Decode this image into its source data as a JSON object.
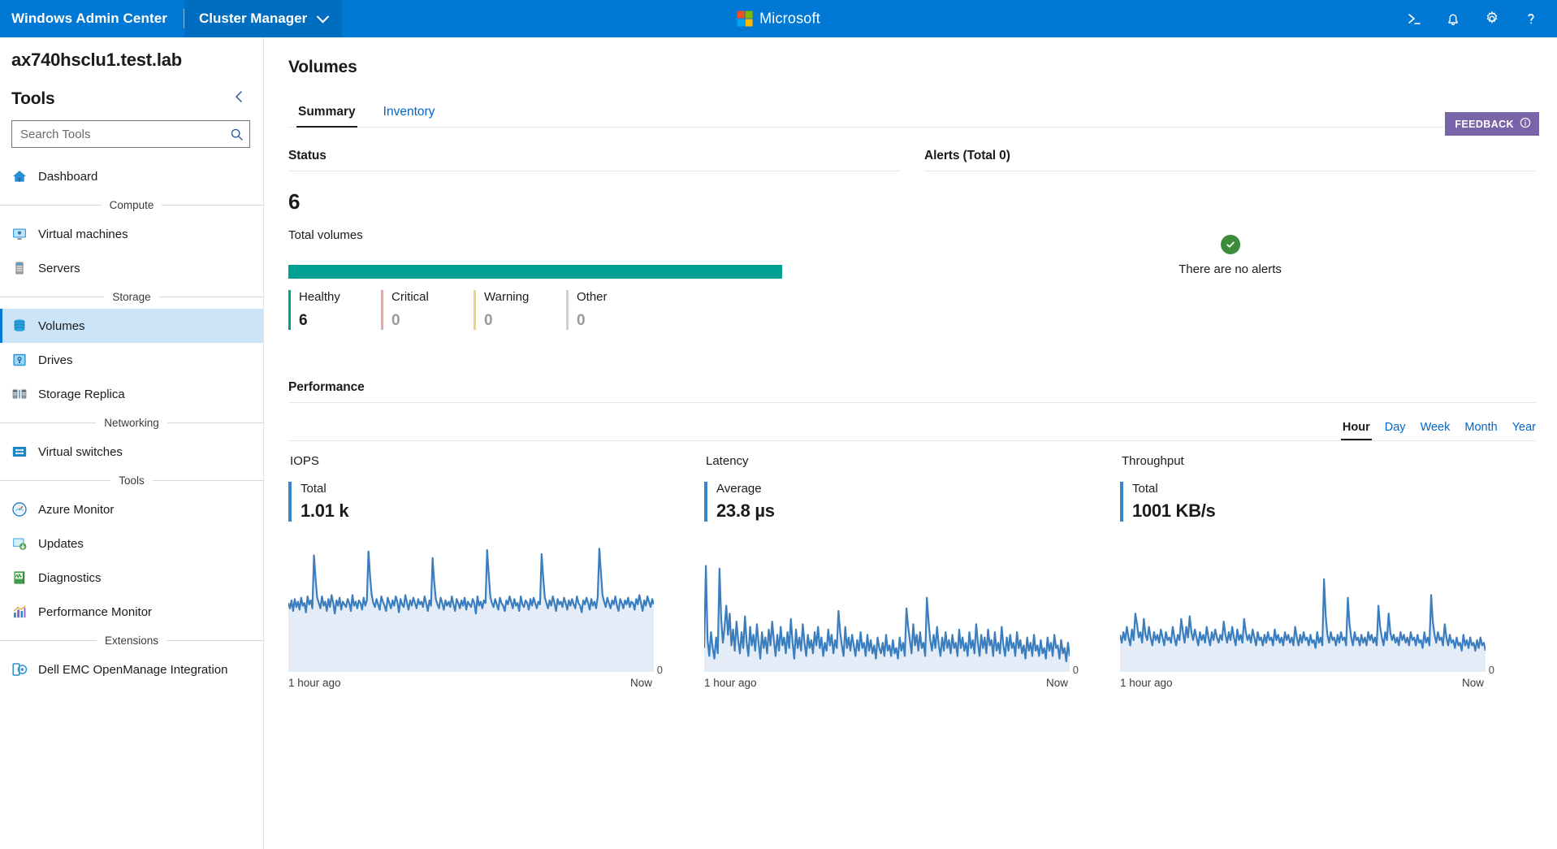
{
  "topbar": {
    "product_name": "Windows Admin Center",
    "solution": "Cluster Manager",
    "solution_chevron_icon": "chevron-down-icon",
    "center_logo_text": "Microsoft",
    "actions": [
      {
        "name": "powershell-icon",
        "label": ">_"
      },
      {
        "name": "notifications-bell-icon",
        "label": "Notifications"
      },
      {
        "name": "settings-gear-icon",
        "label": "Settings"
      },
      {
        "name": "help-question-icon",
        "label": "?"
      }
    ],
    "accent_color": "#0078d4"
  },
  "sidebar": {
    "cluster_name": "ax740hsclu1.test.lab",
    "tools_heading": "Tools",
    "collapse_icon": "chevron-left-icon",
    "search": {
      "placeholder": "Search Tools",
      "value": "",
      "icon": "search-icon"
    },
    "items": [
      {
        "type": "item",
        "label": "Dashboard",
        "icon": "home-icon",
        "selected": false
      },
      {
        "type": "group",
        "label": "Compute"
      },
      {
        "type": "item",
        "label": "Virtual machines",
        "icon": "monitor-icon",
        "selected": false
      },
      {
        "type": "item",
        "label": "Servers",
        "icon": "server-icon",
        "selected": false
      },
      {
        "type": "group",
        "label": "Storage"
      },
      {
        "type": "item",
        "label": "Volumes",
        "icon": "database-icon",
        "selected": true
      },
      {
        "type": "item",
        "label": "Drives",
        "icon": "hard-drive-icon",
        "selected": false
      },
      {
        "type": "item",
        "label": "Storage Replica",
        "icon": "replica-icon",
        "selected": false
      },
      {
        "type": "group",
        "label": "Networking"
      },
      {
        "type": "item",
        "label": "Virtual switches",
        "icon": "switch-icon",
        "selected": false
      },
      {
        "type": "group",
        "label": "Tools"
      },
      {
        "type": "item",
        "label": "Azure Monitor",
        "icon": "gauge-icon",
        "selected": false
      },
      {
        "type": "item",
        "label": "Updates",
        "icon": "updates-icon",
        "selected": false
      },
      {
        "type": "item",
        "label": "Diagnostics",
        "icon": "diagnostics-icon",
        "selected": false
      },
      {
        "type": "item",
        "label": "Performance Monitor",
        "icon": "perf-chart-icon",
        "selected": false
      },
      {
        "type": "group",
        "label": "Extensions"
      },
      {
        "type": "item",
        "label": "Dell EMC OpenManage Integration",
        "icon": "dell-openmanage-icon",
        "selected": false
      }
    ]
  },
  "feedback": {
    "label": "FEEDBACK",
    "icon": "info-circle-icon",
    "color": "#7a64a8"
  },
  "main": {
    "page_title": "Volumes",
    "tabs": [
      {
        "label": "Summary",
        "active": true
      },
      {
        "label": "Inventory",
        "active": false
      }
    ],
    "status": {
      "heading": "Status",
      "total_value": "6",
      "total_label": "Total volumes",
      "bar_color": "#00a193",
      "legend": [
        {
          "label": "Healthy",
          "value": "6",
          "color": "#00a193",
          "zero": false
        },
        {
          "label": "Critical",
          "value": "0",
          "color": "#f1a3a3",
          "zero": true
        },
        {
          "label": "Warning",
          "value": "0",
          "color": "#f5d37a",
          "zero": true
        },
        {
          "label": "Other",
          "value": "0",
          "color": "#cfcfcf",
          "zero": true
        }
      ]
    },
    "alerts": {
      "heading": "Alerts (Total 0)",
      "empty_text": "There are no alerts",
      "empty_icon": "green-check-circle-icon"
    },
    "performance": {
      "heading": "Performance",
      "ranges": [
        {
          "label": "Hour",
          "active": true
        },
        {
          "label": "Day",
          "active": false
        },
        {
          "label": "Week",
          "active": false
        },
        {
          "label": "Month",
          "active": false
        },
        {
          "label": "Year",
          "active": false
        }
      ],
      "metrics": [
        {
          "title": "IOPS",
          "kpi_label": "Total",
          "kpi_value": "1.01 k",
          "axis_zero": "0",
          "foot_left": "1 hour ago",
          "foot_right": "Now"
        },
        {
          "title": "Latency",
          "kpi_label": "Average",
          "kpi_value": "23.8 µs",
          "axis_zero": "0",
          "foot_left": "1 hour ago",
          "foot_right": "Now"
        },
        {
          "title": "Throughput",
          "kpi_label": "Total",
          "kpi_value": "1001 KB/s",
          "axis_zero": "0",
          "foot_left": "1 hour ago",
          "foot_right": "Now"
        }
      ]
    }
  },
  "chart_data": [
    {
      "type": "area",
      "title": "IOPS",
      "xlabel": "",
      "ylabel": "",
      "x_tick_labels": [
        "1 hour ago",
        "Now"
      ],
      "y_tick_labels": [
        "0"
      ],
      "ylim": [
        0,
        100
      ],
      "grid": false,
      "legend": "none",
      "line_color": "#3a7ebf",
      "fill_color": "#e4edf7",
      "values": [
        52,
        48,
        54,
        46,
        55,
        49,
        53,
        47,
        56,
        50,
        52,
        45,
        57,
        51,
        54,
        48,
        88,
        70,
        56,
        52,
        48,
        57,
        50,
        53,
        46,
        55,
        49,
        58,
        52,
        44,
        54,
        50,
        56,
        47,
        53,
        51,
        49,
        55,
        52,
        46,
        58,
        50,
        53,
        48,
        54,
        52,
        47,
        56,
        50,
        54,
        91,
        72,
        58,
        52,
        49,
        55,
        51,
        47,
        57,
        53,
        50,
        46,
        56,
        52,
        48,
        54,
        50,
        57,
        53,
        45,
        55,
        51,
        49,
        58,
        52,
        47,
        54,
        50,
        56,
        52,
        48,
        55,
        51,
        53,
        49,
        57,
        52,
        46,
        54,
        50,
        86,
        68,
        55,
        51,
        48,
        56,
        52,
        47,
        54,
        50,
        53,
        49,
        57,
        51,
        46,
        55,
        52,
        48,
        54,
        50,
        56,
        47,
        53,
        51,
        49,
        55,
        52,
        44,
        57,
        50,
        53,
        48,
        54,
        52,
        92,
        74,
        57,
        52,
        49,
        55,
        51,
        47,
        56,
        52,
        50,
        46,
        54,
        51,
        57,
        53,
        48,
        55,
        50,
        52,
        46,
        57,
        51,
        49,
        54,
        52,
        47,
        55,
        50,
        56,
        52,
        48,
        53,
        51,
        89,
        71,
        56,
        52,
        48,
        54,
        50,
        57,
        52,
        46,
        55,
        51,
        53,
        49,
        56,
        52,
        47,
        54,
        50,
        55,
        51,
        48,
        57,
        52,
        50,
        45,
        54,
        51,
        56,
        52,
        47,
        55,
        50,
        53,
        48,
        57,
        93,
        75,
        58,
        53,
        49,
        56,
        52,
        48,
        54,
        51,
        57,
        50,
        46,
        55,
        52,
        48,
        54,
        51,
        56,
        49,
        53,
        52,
        47,
        55,
        51,
        58,
        52,
        46,
        54,
        50,
        57,
        53,
        49,
        55,
        51
      ]
    },
    {
      "type": "area",
      "title": "Latency",
      "xlabel": "",
      "ylabel": "",
      "x_tick_labels": [
        "1 hour ago",
        "Now"
      ],
      "y_tick_labels": [
        "0"
      ],
      "ylim": [
        0,
        100
      ],
      "grid": false,
      "legend": "none",
      "line_color": "#3a7ebf",
      "fill_color": "#e4edf7",
      "values": [
        18,
        80,
        24,
        12,
        30,
        18,
        10,
        26,
        14,
        78,
        40,
        22,
        34,
        50,
        28,
        44,
        20,
        32,
        16,
        38,
        24,
        14,
        30,
        18,
        42,
        22,
        12,
        34,
        20,
        28,
        16,
        36,
        22,
        10,
        30,
        18,
        26,
        14,
        32,
        20,
        38,
        24,
        12,
        28,
        16,
        34,
        20,
        26,
        14,
        30,
        18,
        40,
        22,
        10,
        32,
        18,
        26,
        16,
        36,
        22,
        12,
        28,
        18,
        24,
        14,
        30,
        20,
        34,
        18,
        26,
        12,
        22,
        16,
        32,
        20,
        28,
        14,
        24,
        18,
        46,
        30,
        20,
        12,
        34,
        18,
        26,
        16,
        28,
        20,
        12,
        24,
        16,
        30,
        18,
        22,
        12,
        28,
        16,
        24,
        14,
        20,
        10,
        26,
        18,
        14,
        22,
        12,
        28,
        16,
        20,
        12,
        24,
        14,
        18,
        10,
        26,
        16,
        22,
        12,
        48,
        34,
        24,
        14,
        36,
        20,
        28,
        16,
        30,
        18,
        22,
        12,
        56,
        38,
        24,
        16,
        28,
        18,
        34,
        20,
        12,
        26,
        16,
        30,
        18,
        24,
        14,
        28,
        18,
        22,
        12,
        32,
        18,
        26,
        16,
        22,
        12,
        30,
        18,
        24,
        14,
        36,
        22,
        12,
        28,
        18,
        26,
        14,
        32,
        20,
        24,
        12,
        30,
        16,
        22,
        14,
        34,
        20,
        12,
        26,
        16,
        28,
        18,
        22,
        12,
        30,
        18,
        24,
        14,
        20,
        10,
        26,
        16,
        22,
        12,
        28,
        16,
        20,
        12,
        24,
        14,
        18,
        10,
        26,
        16,
        22,
        12,
        28,
        18,
        20,
        10,
        24,
        14,
        18,
        8,
        22,
        12
      ]
    },
    {
      "type": "area",
      "title": "Throughput",
      "xlabel": "",
      "ylabel": "",
      "x_tick_labels": [
        "1 hour ago",
        "Now"
      ],
      "y_tick_labels": [
        "0"
      ],
      "ylim": [
        0,
        100
      ],
      "grid": false,
      "legend": "none",
      "line_color": "#3a7ebf",
      "fill_color": "#e4edf7",
      "values": [
        28,
        22,
        30,
        24,
        34,
        26,
        20,
        32,
        24,
        44,
        36,
        26,
        30,
        22,
        40,
        28,
        24,
        34,
        26,
        20,
        30,
        24,
        28,
        22,
        32,
        26,
        20,
        30,
        24,
        26,
        22,
        34,
        26,
        20,
        28,
        24,
        40,
        30,
        22,
        34,
        26,
        42,
        30,
        24,
        32,
        26,
        20,
        30,
        24,
        28,
        22,
        34,
        26,
        20,
        30,
        24,
        32,
        26,
        22,
        28,
        24,
        38,
        28,
        22,
        30,
        24,
        34,
        26,
        20,
        32,
        24,
        28,
        22,
        40,
        30,
        24,
        28,
        22,
        32,
        26,
        20,
        30,
        24,
        26,
        20,
        28,
        22,
        30,
        24,
        26,
        20,
        32,
        24,
        28,
        22,
        26,
        20,
        30,
        24,
        28,
        22,
        26,
        20,
        34,
        26,
        20,
        28,
        22,
        30,
        24,
        26,
        20,
        28,
        22,
        24,
        18,
        30,
        22,
        26,
        20,
        70,
        42,
        28,
        22,
        30,
        24,
        26,
        20,
        28,
        22,
        30,
        24,
        26,
        20,
        56,
        36,
        26,
        20,
        30,
        24,
        26,
        20,
        28,
        22,
        26,
        20,
        30,
        24,
        28,
        22,
        26,
        20,
        50,
        34,
        26,
        20,
        30,
        24,
        44,
        30,
        24,
        28,
        22,
        26,
        20,
        30,
        24,
        28,
        22,
        26,
        20,
        30,
        24,
        26,
        20,
        28,
        22,
        24,
        18,
        30,
        22,
        26,
        20,
        58,
        38,
        28,
        22,
        30,
        24,
        26,
        20,
        36,
        26,
        20,
        28,
        22,
        24,
        18,
        26,
        20,
        22,
        16,
        28,
        20,
        24,
        18,
        26,
        20,
        22,
        16,
        24,
        18,
        26,
        20,
        22,
        16
      ]
    }
  ]
}
